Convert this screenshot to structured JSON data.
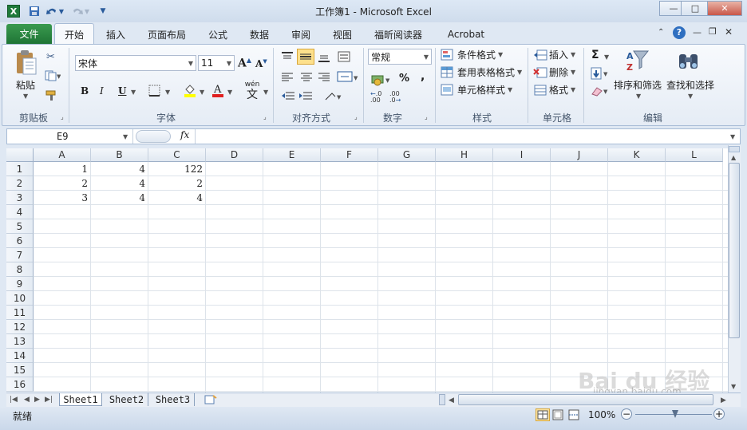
{
  "titlebar": {
    "title": "工作簿1 - Microsoft Excel",
    "app_icon": "X",
    "minimize_icon": "—",
    "restore_icon": "□",
    "close_icon": "✕"
  },
  "tabs": {
    "file": "文件",
    "home": "开始",
    "insert": "插入",
    "page_layout": "页面布局",
    "formulas": "公式",
    "data": "数据",
    "review": "审阅",
    "view": "视图",
    "foxit": "福昕阅读器",
    "acrobat": "Acrobat"
  },
  "ribbon": {
    "clipboard": {
      "paste": "粘贴",
      "label": "剪贴板"
    },
    "font": {
      "name": "宋体",
      "size": "11",
      "bold": "B",
      "italic": "I",
      "underline": "U",
      "label": "字体",
      "grow": "A",
      "shrink": "A",
      "wen": "wén",
      "zi": "文"
    },
    "alignment": {
      "label": "对齐方式"
    },
    "number": {
      "format": "常规",
      "percent": "%",
      "comma": ",",
      "label": "数字",
      "dec_inc": ".0 .00",
      "dec_dec": ".00 .0"
    },
    "styles": {
      "conditional": "条件格式",
      "table": "套用表格格式",
      "cell": "单元格样式",
      "label": "样式"
    },
    "cells": {
      "insert": "插入",
      "delete": "删除",
      "format": "格式",
      "label": "单元格"
    },
    "editing": {
      "sigma": "Σ",
      "sort": "排序和筛选",
      "find": "查找和选择",
      "label": "编辑"
    }
  },
  "formula_bar": {
    "name_box": "E9",
    "fx": "fx",
    "value": ""
  },
  "grid": {
    "columns": [
      "A",
      "B",
      "C",
      "D",
      "E",
      "F",
      "G",
      "H",
      "I",
      "J",
      "K",
      "L"
    ],
    "rows": [
      "1",
      "2",
      "3",
      "4",
      "5",
      "6",
      "7",
      "8",
      "9",
      "10",
      "11",
      "12",
      "13",
      "14",
      "15",
      "16"
    ],
    "cells": {
      "A1": "1",
      "B1": "4",
      "C1": "122",
      "A2": "2",
      "B2": "4",
      "C2": "2",
      "A3": "3",
      "B3": "4",
      "C3": "4"
    }
  },
  "sheets": [
    "Sheet1",
    "Sheet2",
    "Sheet3"
  ],
  "status": {
    "ready": "就绪",
    "zoom": "100%",
    "zoom_out": "−",
    "zoom_in": "+"
  },
  "watermark": {
    "logo": "Bai du 经验",
    "url": "jingyan.baidu.com"
  }
}
